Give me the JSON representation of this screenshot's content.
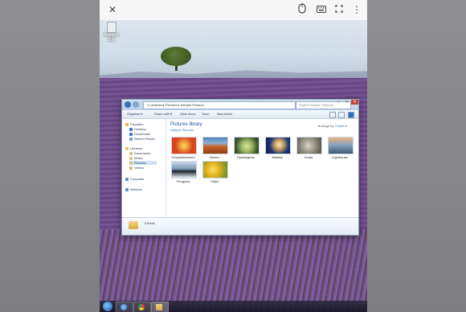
{
  "topbar": {
    "close_icon": "close-icon",
    "mouse_icon": "mouse-icon",
    "keyboard_icon": "keyboard-icon",
    "fullscreen_icon": "fullscreen-icon",
    "more_icon": "more-vertical-icon"
  },
  "desktop": {
    "recycle_bin_label": "Recycle Bin"
  },
  "explorer": {
    "address": "« Libraries ▸ Pictures ▸ Sample Pictures",
    "search_placeholder": "Search Sample Pictures",
    "toolbar": {
      "organize": "Organize ▾",
      "share": "Share with ▾",
      "slideshow": "Slide show",
      "burn": "Burn",
      "new_folder": "New folder"
    },
    "nav": {
      "favorites": "Favorites",
      "desktop": "Desktop",
      "downloads": "Downloads",
      "recent": "Recent Places",
      "libraries": "Libraries",
      "documents": "Documents",
      "music": "Music",
      "pictures": "Pictures",
      "videos": "Videos",
      "computer": "Computer",
      "network": "Network"
    },
    "library_title": "Pictures library",
    "library_subtitle": "Sample Pictures",
    "arrange_by_label": "Arrange by:",
    "arrange_by_value": "Folder ▾",
    "thumbnails": [
      {
        "label": "Chrysanthemum",
        "color": "#d8461f"
      },
      {
        "label": "Desert",
        "color": "#b8551c"
      },
      {
        "label": "Hydrangeas",
        "color": "#9fb866"
      },
      {
        "label": "Jellyfish",
        "color": "#2a4d8f"
      },
      {
        "label": "Koala",
        "color": "#8e8a7e"
      },
      {
        "label": "Lighthouse",
        "color": "#6b87a5"
      },
      {
        "label": "Penguins",
        "color": "#5d7c9a"
      },
      {
        "label": "Tulips",
        "color": "#e2b11d"
      }
    ],
    "items_count": "8 items"
  },
  "taskbar": {
    "start_icon": "windows-start-icon",
    "items": [
      "internet-explorer-icon",
      "chrome-icon",
      "explorer-folder-icon"
    ]
  }
}
